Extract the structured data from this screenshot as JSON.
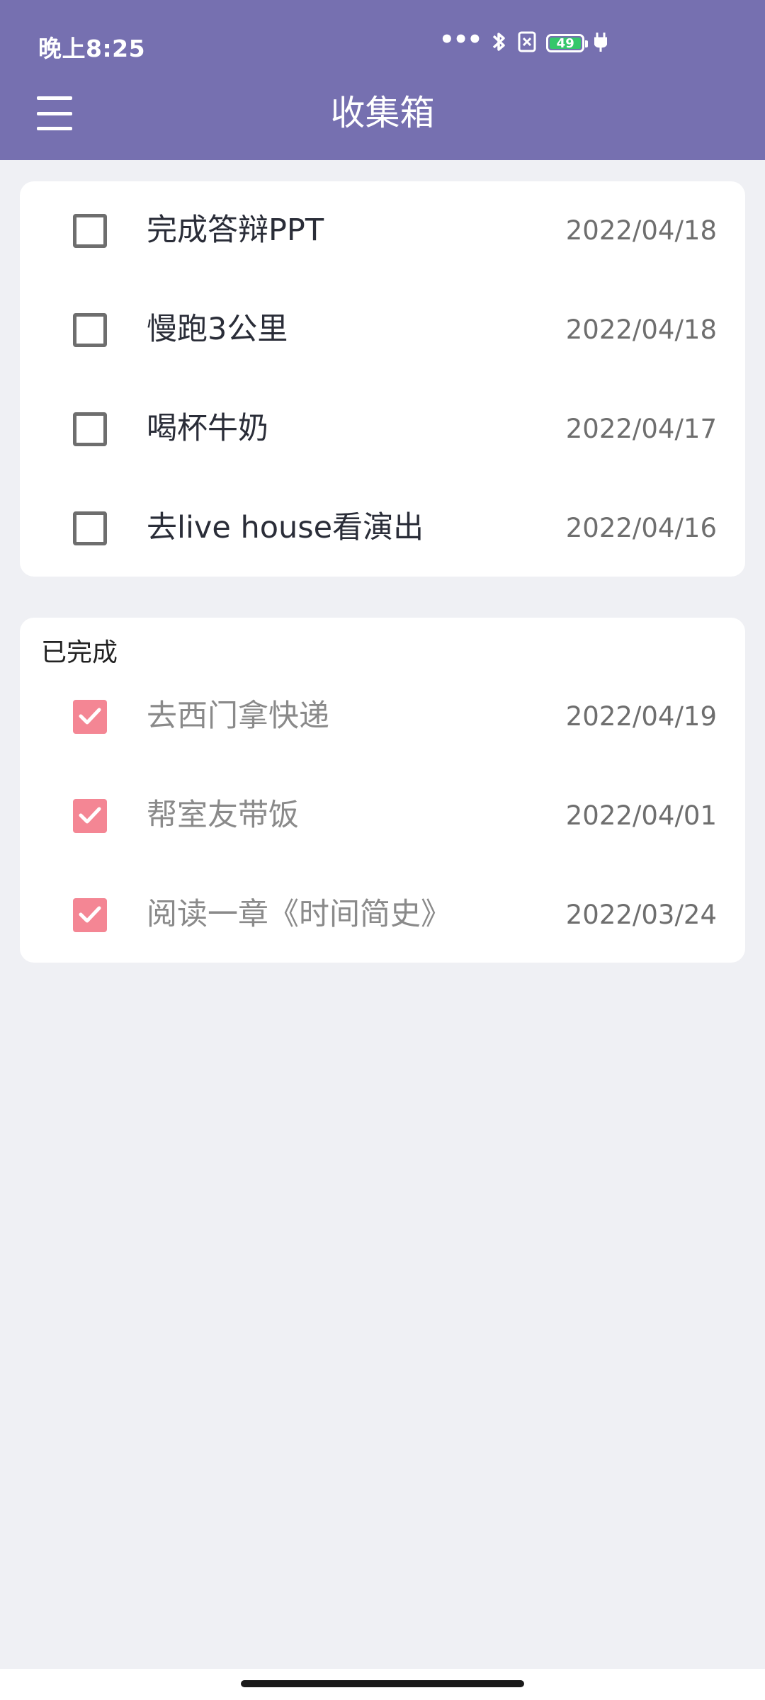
{
  "status_bar": {
    "time": "晚上8:25",
    "battery_level": "49",
    "icons": [
      "more-dots-icon",
      "bluetooth-icon",
      "no-sim-icon",
      "battery-icon",
      "charging-icon"
    ]
  },
  "toolbar": {
    "title": "收集箱",
    "menu_icon": "hamburger-menu-icon"
  },
  "todo": {
    "items": [
      {
        "label": "完成答辩PPT",
        "date": "2022/04/18",
        "checked": false
      },
      {
        "label": "慢跑3公里",
        "date": "2022/04/18",
        "checked": false
      },
      {
        "label": "喝杯牛奶",
        "date": "2022/04/17",
        "checked": false
      },
      {
        "label": "去live house看演出",
        "date": "2022/04/16",
        "checked": false
      }
    ]
  },
  "done": {
    "title": "已完成",
    "items": [
      {
        "label": "去西门拿快递",
        "date": "2022/04/19",
        "checked": true
      },
      {
        "label": "帮室友带饭",
        "date": "2022/04/01",
        "checked": true
      },
      {
        "label": "阅读一章《时间简史》",
        "date": "2022/03/24",
        "checked": true
      }
    ]
  },
  "colors": {
    "appbar": "#7670B0",
    "background": "#EFF0F4",
    "checked": "#F48694",
    "battery": "#35C76B"
  }
}
